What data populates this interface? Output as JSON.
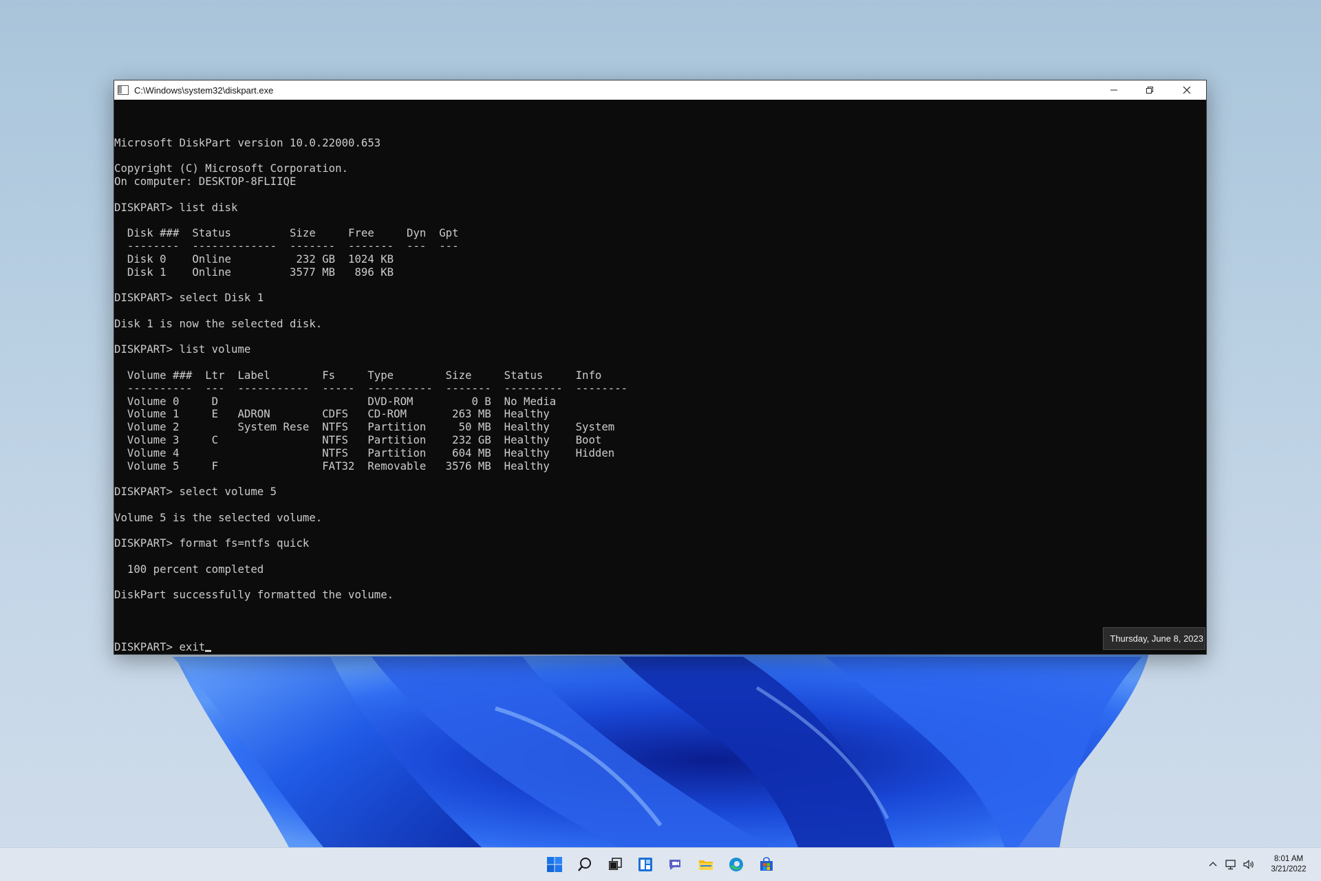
{
  "window": {
    "title": "C:\\Windows\\system32\\diskpart.exe"
  },
  "console": {
    "lines": [
      "Microsoft DiskPart version 10.0.22000.653",
      "",
      "Copyright (C) Microsoft Corporation.",
      "On computer: DESKTOP-8FLIIQE",
      "",
      "DISKPART> list disk",
      "",
      "  Disk ###  Status         Size     Free     Dyn  Gpt",
      "  --------  -------------  -------  -------  ---  ---",
      "  Disk 0    Online          232 GB  1024 KB",
      "  Disk 1    Online         3577 MB   896 KB",
      "",
      "DISKPART> select Disk 1",
      "",
      "Disk 1 is now the selected disk.",
      "",
      "DISKPART> list volume",
      "",
      "  Volume ###  Ltr  Label        Fs     Type        Size     Status     Info",
      "  ----------  ---  -----------  -----  ----------  -------  ---------  --------",
      "  Volume 0     D                       DVD-ROM         0 B  No Media",
      "  Volume 1     E   ADRON        CDFS   CD-ROM       263 MB  Healthy",
      "  Volume 2         System Rese  NTFS   Partition     50 MB  Healthy    System",
      "  Volume 3     C                NTFS   Partition    232 GB  Healthy    Boot",
      "  Volume 4                      NTFS   Partition    604 MB  Healthy    Hidden",
      "  Volume 5     F                FAT32  Removable   3576 MB  Healthy",
      "",
      "DISKPART> select volume 5",
      "",
      "Volume 5 is the selected volume.",
      "",
      "DISKPART> format fs=ntfs quick",
      "",
      "  100 percent completed",
      "",
      "DiskPart successfully formatted the volume.",
      ""
    ],
    "prompt": "DISKPART> exit"
  },
  "tooltip": "Thursday, June 8, 2023",
  "taskbar": {
    "apps": [
      {
        "name": "start-icon"
      },
      {
        "name": "search-icon"
      },
      {
        "name": "task-view-icon"
      },
      {
        "name": "widgets-icon"
      },
      {
        "name": "chat-icon"
      },
      {
        "name": "file-explorer-icon"
      },
      {
        "name": "edge-icon"
      },
      {
        "name": "store-icon"
      }
    ],
    "clock": {
      "time": "8:01 AM",
      "date": "3/21/2022"
    }
  }
}
